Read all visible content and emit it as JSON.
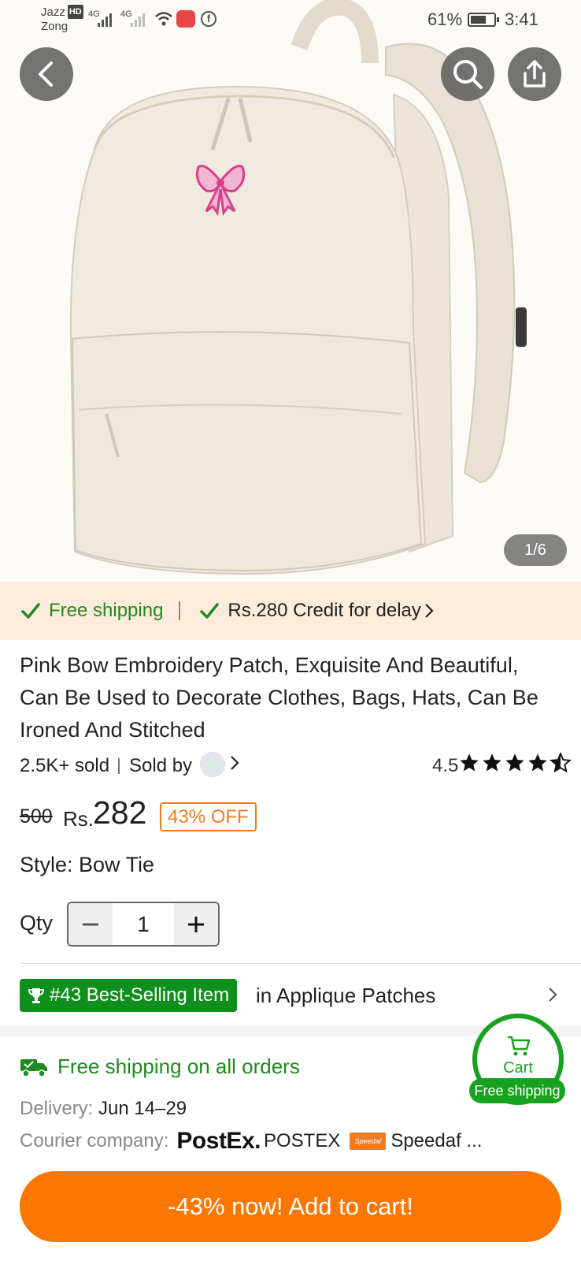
{
  "status_bar": {
    "carrier1": "Jazz",
    "hd_badge": "HD",
    "carrier2": "Zong",
    "net1": "4G",
    "net2": "4G",
    "battery": "61%",
    "time": "3:41"
  },
  "gallery": {
    "counter": "1/6"
  },
  "shipping_strip": {
    "free_shipping": "Free shipping",
    "credit": "Rs.280 Credit for delay"
  },
  "product": {
    "title": "Pink Bow Embroidery Patch, Exquisite And Beautiful, Can Be Used to Decorate Clothes, Bags, Hats, Can Be Ironed And Stitched",
    "sold": "2.5K+ sold",
    "sold_by": "Sold by",
    "rating": "4.5",
    "rating_stars": 4.5,
    "old_price": "500",
    "currency": "Rs.",
    "price": "282",
    "discount": "43% OFF",
    "style": "Style: Bow Tie",
    "qty_label": "Qty",
    "qty_value": "1"
  },
  "best_selling": {
    "badge": "#43 Best-Selling Item",
    "category": "in Applique Patches"
  },
  "shipping": {
    "title": "Free shipping on all orders",
    "delivery_label": "Delivery:",
    "delivery_value": "Jun 14–29",
    "courier_label": "Courier company:",
    "courier_logo": "PostEx.",
    "courier1": "POSTEX",
    "courier2_logo": "Speedaf",
    "courier2": "Speedaf ..."
  },
  "cart_float": {
    "label": "Cart",
    "badge": "Free shipping"
  },
  "cta": {
    "label": "-43% now! Add to cart!"
  },
  "colors": {
    "accent_orange": "#fb7701",
    "green": "#1f8b1f",
    "strip_bg": "#fdebdc",
    "bow_pink": "#e0579a"
  }
}
